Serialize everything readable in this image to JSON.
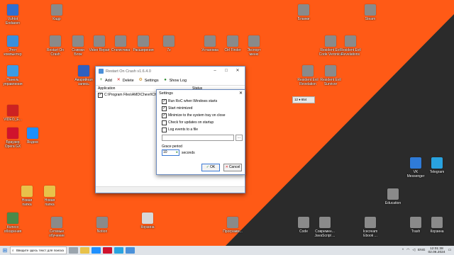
{
  "desktop": {
    "colors": {
      "background": "#ff5a16",
      "wedge": "#2b2b2b"
    },
    "icons_left": [
      {
        "label": "Vuhtot\nEndaeen",
        "icon": "app-icon",
        "color": "#2f6fd1"
      },
      {
        "label": "Этот\nкомпьютер",
        "icon": "computer-icon",
        "color": "#3a8fdc"
      },
      {
        "label": "Панель\nуправления",
        "icon": "control-panel-icon",
        "color": "#3c9be6"
      },
      {
        "label": "VIDEO_E...",
        "icon": "video-icon",
        "color": "#cc2222"
      },
      {
        "label": "Браузер\nOpera GX",
        "icon": "opera-icon",
        "color": "#d0132d"
      },
      {
        "label": "Аварийная\nзапись",
        "icon": "app-icon",
        "color": "#3060c0"
      },
      {
        "label": "Яндекс",
        "icon": "yandex-icon",
        "color": "#1e90ff"
      },
      {
        "label": "Новая\nпапка",
        "icon": "folder-icon",
        "color": "#e8c24a"
      },
      {
        "label": "Новая\nпапка",
        "icon": "folder-icon",
        "color": "#e8c24a"
      },
      {
        "label": "Колесо\nобозрения",
        "icon": "app-icon",
        "color": "#4a8a4a"
      },
      {
        "label": "Корзина",
        "icon": "trash-icon",
        "color": "#d8d8d8"
      }
    ],
    "icons_top": [
      {
        "label": "Кадр",
        "icon": "app-icon"
      },
      {
        "label": "Restart On\nCrash",
        "icon": "restart-icon"
      },
      {
        "label": "Снимки\nБлок",
        "icon": "app-icon"
      },
      {
        "label": "Video Repair",
        "icon": "video-icon"
      },
      {
        "label": "Статистика",
        "icon": "app-icon"
      },
      {
        "label": "Расширения",
        "icon": "app-icon"
      },
      {
        "label": "7z",
        "icon": "archive-icon"
      },
      {
        "label": "Установка",
        "icon": "app-icon"
      },
      {
        "label": "Ctrl Finder",
        "icon": "app-icon"
      },
      {
        "label": "Экспорт\nменю",
        "icon": "app-icon"
      },
      {
        "label": "Resident Evil\nCode Veronica",
        "icon": "game-icon"
      },
      {
        "label": "Resident Evil\nRevelations",
        "icon": "game-icon"
      },
      {
        "label": "Resident Evil\nRevelation",
        "icon": "game-icon"
      },
      {
        "label": "Resident Evil\nSurvivor",
        "icon": "game-icon"
      }
    ],
    "icons_right": [
      {
        "label": "Бланки",
        "icon": "doc-icon"
      },
      {
        "label": "Steam",
        "icon": "steam-icon"
      },
      {
        "label": "VK\nMessenger",
        "icon": "vk-icon",
        "color": "#2f7bd8"
      },
      {
        "label": "Telegram",
        "icon": "telegram-icon",
        "color": "#29a3e0"
      },
      {
        "label": "Education",
        "icon": "app-icon"
      },
      {
        "label": "Trash",
        "icon": "trash-icon"
      },
      {
        "label": "Корзина",
        "icon": "trash-icon"
      }
    ],
    "icons_bottom": [
      {
        "label": "Code",
        "icon": "code-icon"
      },
      {
        "label": "Современ...\nJavaScript ...",
        "icon": "folder-icon"
      },
      {
        "label": "Icecream\nEbook ...",
        "icon": "app-icon"
      },
      {
        "label": "Notion",
        "icon": "notion-icon"
      },
      {
        "label": "Сетевые\nобучение",
        "icon": "app-icon"
      },
      {
        "label": "Программ...",
        "icon": "app-icon"
      }
    ],
    "badge": {
      "text": "12 ♦ 654"
    }
  },
  "roc_window": {
    "title": "Restart On Crash v1.6.4.0",
    "toolbar": {
      "add": "Add",
      "delete": "Delete",
      "settings": "Settings",
      "show_log": "Show Log"
    },
    "list": {
      "header_app": "Application",
      "header_status": "Status",
      "row_path": "C:\\Program Files\\AMD\\Chevrl\\Chevrl.exe"
    }
  },
  "settings": {
    "title": "Settings",
    "options": [
      {
        "label": "Run RoC when Windows starts",
        "checked": true
      },
      {
        "label": "Start minimized",
        "checked": true
      },
      {
        "label": "Minimize to the system tray on close",
        "checked": true
      },
      {
        "label": "Check for updates on startup",
        "checked": false
      },
      {
        "label": "Log events to a file",
        "checked": false
      }
    ],
    "log_path_placeholder": "",
    "browse_label": "...",
    "grace_label": "Grace period",
    "grace_value": "10",
    "grace_unit": "seconds",
    "ok": "OK",
    "cancel": "Cancel"
  },
  "taskbar": {
    "search_placeholder": "Введите здесь текст для поиска",
    "lang": "ENG",
    "time": "12:01:38",
    "date": "02.06.2024"
  }
}
